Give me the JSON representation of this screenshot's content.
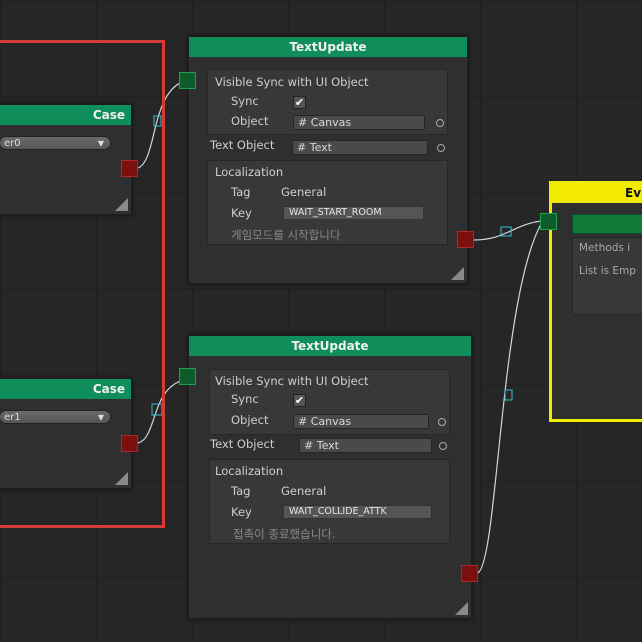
{
  "case_nodes": [
    {
      "title": "Case",
      "dropdown": "er0"
    },
    {
      "title": "Case",
      "dropdown": "er1"
    }
  ],
  "text_update_nodes": [
    {
      "title": "TextUpdate",
      "visible_sync_label": "Visible Sync with UI Object",
      "sync_label": "Sync",
      "sync_checked": "✔",
      "object_label": "Object",
      "object_value": "# Canvas",
      "text_object_label": "Text Object",
      "text_object_value": "# Text",
      "localization_label": "Localization",
      "tag_label": "Tag",
      "tag_value": "General",
      "key_label": "Key",
      "key_value": "WAIT_START_ROOM",
      "localized_text": "게임모드를 시작합니다"
    },
    {
      "title": "TextUpdate",
      "visible_sync_label": "Visible Sync with UI Object",
      "sync_label": "Sync",
      "sync_checked": "✔",
      "object_label": "Object",
      "object_value": "# Canvas",
      "text_object_label": "Text Object",
      "text_object_value": "# Text",
      "localization_label": "Localization",
      "tag_label": "Tag",
      "tag_value": "General",
      "key_label": "Key",
      "key_value": "WAIT_COLLIDE_ATTK",
      "localized_text": "접촉이 종료했습니다."
    }
  ],
  "event_node": {
    "title": "Ev",
    "methods_label": "Methods i",
    "list_label": "List is Emp"
  },
  "colors": {
    "node_header": "#0f8e5c",
    "group_frame": "#d63a32",
    "event_frame": "#f2ea00",
    "wire": "#cfd8d8",
    "wire_marker": "#3bc0d0"
  }
}
